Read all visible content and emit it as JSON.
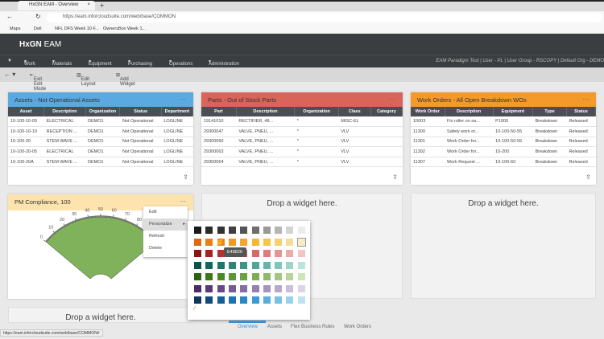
{
  "browser": {
    "tab_title": "HxGN EAM - Overview",
    "url": "https://eam.inforcloudsuite.com/web/base/COMMON",
    "bookmarks": [
      "Maps",
      "Dell",
      "NFL DFS Week 10 F...",
      "OwnersBox Week 1..."
    ]
  },
  "app": {
    "logo": "HxGN",
    "logo_suffix": "EAM",
    "nav": [
      "Work",
      "Materials",
      "Equipment",
      "Purchasing",
      "Operations",
      "Administration"
    ],
    "user_info": "EAM Paradigm Test | User - PL | User Group - RSCOPY | Default Org - DEMO"
  },
  "toolbar": {
    "exit_edit": "Exit Edit Mode",
    "edit_layout": "Edit Layout",
    "add_widget": "Add Widget"
  },
  "widgets": {
    "assets": {
      "title": "Assets - Not Operational Assets",
      "color": "#5aa9e0",
      "columns": [
        "Asset",
        "Description",
        "Organization",
        "Status",
        "Department"
      ],
      "rows": [
        [
          "10-100-10-05",
          "ELECTRICAL",
          "DEMO1",
          "Not Operational",
          "LOGLINE"
        ],
        [
          "10-100-10-10",
          "RECEPTION ...",
          "DEMO1",
          "Not Operational",
          "LOGLINE"
        ],
        [
          "10-100-20",
          "STEM WAVE ...",
          "DEMO1",
          "Not Operational",
          "LOGLINE"
        ],
        [
          "10-100-20-05",
          "ELECTRICAL",
          "DEMO1",
          "Not Operational",
          "LOGLINE"
        ],
        [
          "10-100-20A",
          "STEM WAVE ...",
          "DEMO1",
          "Not Operational",
          "LOGLINE"
        ]
      ]
    },
    "parts": {
      "title": "Parts - Out of Stock Parts",
      "color": "#d9645a",
      "columns": [
        "Part",
        "Description",
        "Organization",
        "Class",
        "Category"
      ],
      "rows": [
        [
          "19141010",
          "RECTIFIER, 48...",
          "*",
          "MISC-EL",
          ""
        ],
        [
          "29300047",
          "VALVE, PNEU, ...",
          "*",
          "VLV",
          ""
        ],
        [
          "29300050",
          "VALVE, PNEU, ...",
          "*",
          "VLV",
          ""
        ],
        [
          "29300063",
          "VALVE, PNEU, ...",
          "*",
          "VLV",
          ""
        ],
        [
          "29300064",
          "VALVE, PNEU, ...",
          "*",
          "VLV",
          ""
        ]
      ]
    },
    "workorders": {
      "title": "Work Orders - All Open Breakdown WOs",
      "color": "#f39a2a",
      "columns": [
        "Work Order",
        "Description",
        "Equipment",
        "Type",
        "Status"
      ],
      "rows": [
        [
          "10003",
          "Fix roller on sa...",
          "P1000",
          "Breakdown",
          "Released"
        ],
        [
          "11300",
          "Safety work or...",
          "10-100-50-55",
          "Breakdown",
          "Released"
        ],
        [
          "11301",
          "Work Order for...",
          "10-100-50-55",
          "Breakdown",
          "Released"
        ],
        [
          "11302",
          "Work Order for...",
          "10-200",
          "Breakdown",
          "Released"
        ],
        [
          "11307",
          "Work Request ...",
          "10-100-60",
          "Breakdown",
          "Released"
        ]
      ]
    },
    "pm": {
      "title": "PM Compliance, 100",
      "color": "#fde3ad",
      "gauge_value": 100,
      "gauge_ticks": [
        "0",
        "10",
        "20",
        "30",
        "40",
        "50",
        "60",
        "70",
        "80"
      ],
      "gauge_color": "#7fb25a"
    }
  },
  "drop_text": "Drop a widget here.",
  "context_menu": [
    "Edit",
    "Personalize",
    "Refresh",
    "Delete"
  ],
  "palette": {
    "rows": [
      [
        "#1a1a1a",
        "#2b2b2b",
        "#333333",
        "#404040",
        "#555555",
        "#6e6e6e",
        "#999999",
        "#b5b5b5",
        "#d4d4d4",
        "#ececec"
      ],
      [
        "#e06a10",
        "#e5801c",
        "#e48826",
        "#f19a24",
        "#f3a52c",
        "#f5b834",
        "#f5c548",
        "#f5d070",
        "#f5dc98",
        "#fbecc6"
      ],
      [
        "#8b1313",
        "#a82020",
        "#b73030",
        "#c24242",
        "#cc5656",
        "#d46a6a",
        "#dc7e7e",
        "#e49494",
        "#ecabab",
        "#f3c6c6"
      ],
      [
        "#0d5248",
        "#17645a",
        "#217468",
        "#2f8478",
        "#3f948a",
        "#52a49a",
        "#68b4aa",
        "#80c4ba",
        "#9cd4ca",
        "#bae3dc"
      ],
      [
        "#2a6410",
        "#3a7818",
        "#4a8a24",
        "#5a9632",
        "#6aa242",
        "#7cae54",
        "#8eba68",
        "#a2c67e",
        "#b8d498",
        "#cfe4b8"
      ],
      [
        "#4a2a68",
        "#583a78",
        "#664a88",
        "#765c96",
        "#866ea4",
        "#9680b2",
        "#a694c0",
        "#b8a8ce",
        "#cbbedc",
        "#ded4ea"
      ],
      [
        "#10365e",
        "#134a7a",
        "#185e96",
        "#1e72b0",
        "#2a86c4",
        "#3e9ad2",
        "#5aaedc",
        "#78c0e4",
        "#9ad2ec",
        "#bee2f2"
      ]
    ],
    "tooltip": "E48826",
    "selected": "#fbecc6"
  },
  "bottom_tabs": [
    "Overview",
    "Assets",
    "Flex Business Rules",
    "Work Orders"
  ],
  "status_url": "https://eam.inforcloudsuite.com/web/base/COMMON#"
}
